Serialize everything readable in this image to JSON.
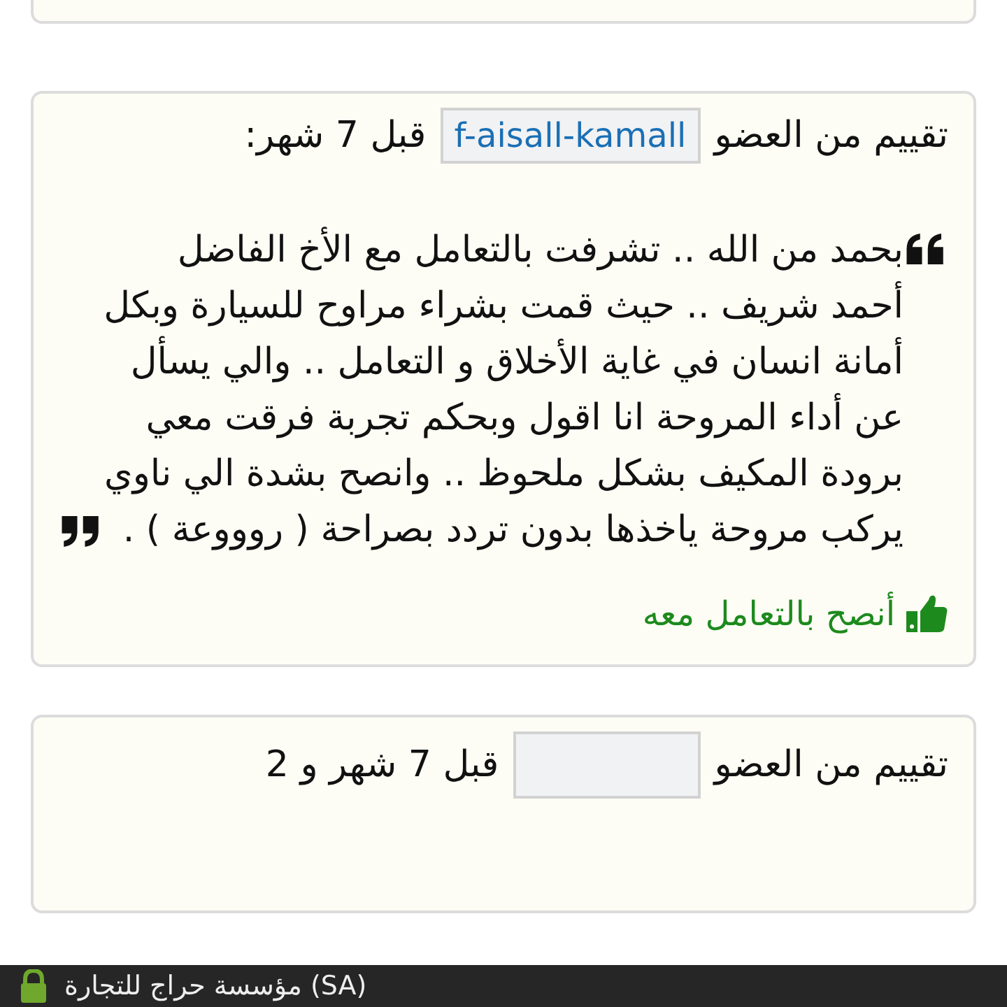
{
  "reviews": [
    {
      "kind": "cut"
    },
    {
      "kind": "full",
      "prefix": "تقييم من العضو",
      "username": "f-aisall-kamall",
      "time": "قبل 7 شهر:",
      "body": "بحمد من الله .. تشرفت بالتعامل مع الأخ الفاضل أحمد شريف .. حيث قمت بشراء مراوح للسيارة وبكل أمانة انسان في غاية الأخلاق و التعامل .. والي يسأل عن أداء المروحة انا اقول وبحكم تجربة فرقت معي برودة المكيف بشكل ملحوظ .. وانصح بشدة الي ناوي يركب مروحة ياخذها بدون تردد بصراحة ( روووعة ) .",
      "recommend": "أنصح بالتعامل معه"
    },
    {
      "kind": "partial",
      "prefix": "تقييم من العضو",
      "time": "قبل 7 شهر و 2"
    }
  ],
  "status_bar": {
    "text": "مؤسسة حراج للتجارة (SA)"
  }
}
